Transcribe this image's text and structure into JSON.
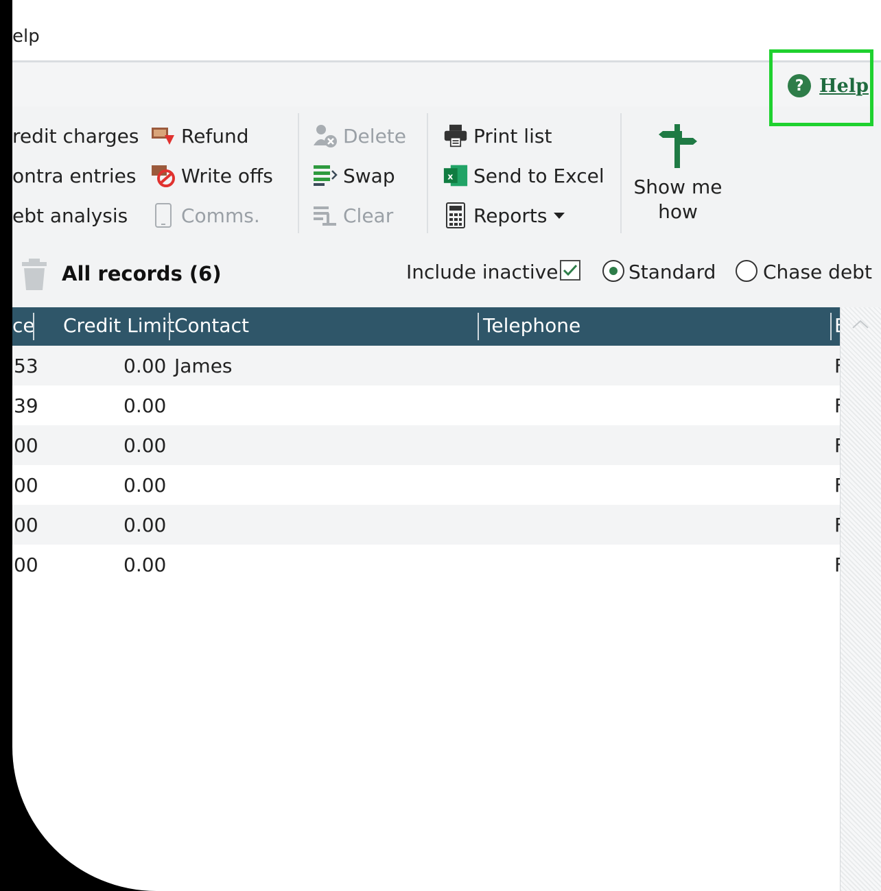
{
  "menu": {
    "help_label": "elp"
  },
  "helpbar": {
    "help_link": "Help",
    "help_icon": "?"
  },
  "ribbon": {
    "group1": [
      "redit charges",
      "ontra entries",
      "ebt analysis"
    ],
    "group2": {
      "refund": "Refund",
      "write_offs": "Write offs",
      "comms": "Comms."
    },
    "group3": {
      "delete": "Delete",
      "swap": "Swap",
      "clear": "Clear"
    },
    "group4": {
      "print_list": "Print list",
      "send_to_excel": "Send to Excel",
      "reports": "Reports"
    },
    "show_me_how": {
      "line1": "Show me",
      "line2": "how"
    }
  },
  "filter": {
    "title": "All records (6)",
    "include_inactive_label": "Include inactive",
    "include_inactive_checked": true,
    "standard_label": "Standard",
    "chase_debt_label": "Chase debt",
    "selected_mode": "Standard"
  },
  "grid": {
    "headers": {
      "col0": "ce",
      "credit_limit": "Credit Limit",
      "contact": "Contact",
      "telephone": "Telephone",
      "last": "E"
    },
    "rows": [
      {
        "c0": "53",
        "credit_limit": "0.00",
        "contact": "James",
        "last": "F"
      },
      {
        "c0": "39",
        "credit_limit": "0.00",
        "contact": "",
        "last": "F"
      },
      {
        "c0": "00",
        "credit_limit": "0.00",
        "contact": "",
        "last": "F"
      },
      {
        "c0": "00",
        "credit_limit": "0.00",
        "contact": "",
        "last": "F"
      },
      {
        "c0": "00",
        "credit_limit": "0.00",
        "contact": "",
        "last": "F"
      },
      {
        "c0": "00",
        "credit_limit": "0.00",
        "contact": "",
        "last": "F"
      }
    ]
  },
  "colors": {
    "accent_green": "#2e7d49",
    "header_bg": "#2f5669",
    "highlight": "#1fd12f"
  }
}
